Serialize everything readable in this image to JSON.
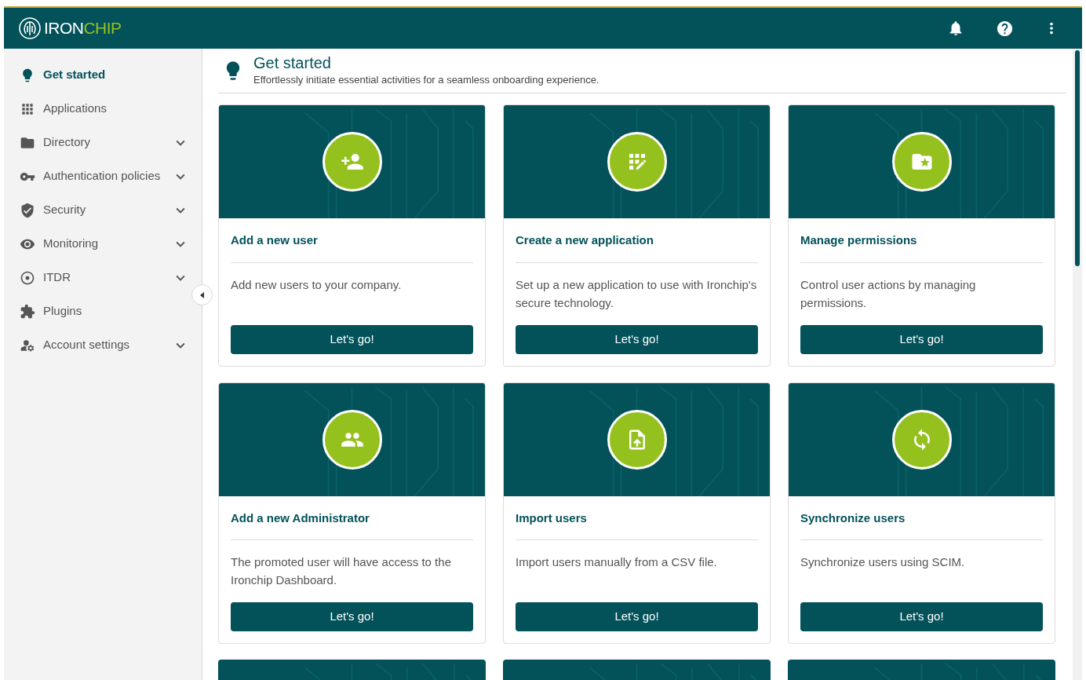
{
  "topbar": {
    "logo": {
      "part_1": "IRON",
      "part_2": "CHIP"
    }
  },
  "sidebar": {
    "items": [
      {
        "label": "Get started",
        "selected": true
      },
      {
        "label": "Applications",
        "selected": false
      },
      {
        "label": "Directory",
        "selected": false,
        "expanded": false
      },
      {
        "label": "Authentication policies",
        "selected": false,
        "expanded": false
      },
      {
        "label": "Security",
        "selected": false,
        "expanded": false
      },
      {
        "label": "Monitoring",
        "selected": false,
        "expanded": false
      },
      {
        "label": "ITDR",
        "selected": false,
        "expanded": false
      },
      {
        "label": "Plugins",
        "selected": false
      },
      {
        "label": "Account settings",
        "selected": false,
        "expanded": false
      }
    ]
  },
  "page": {
    "title": "Get started",
    "subtitle": "Effortlessly initiate essential activities for a seamless onboarding experience."
  },
  "cards": [
    {
      "title": "Add a new user",
      "description": "Add new users to your company.",
      "button": "Let's go!"
    },
    {
      "title": "Create a new application",
      "description": "Set up a new application to use with Ironchip's secure technology.",
      "button": "Let's go!"
    },
    {
      "title": "Manage permissions",
      "description": "Control user actions by managing permissions.",
      "button": "Let's go!"
    },
    {
      "title": "Add a new Administrator",
      "description": "The promoted user will have access to the Ironchip Dashboard.",
      "button": "Let's go!"
    },
    {
      "title": "Import users",
      "description": "Import users manually from a CSV file.",
      "button": "Let's go!"
    },
    {
      "title": "Synchronize users",
      "description": "Synchronize users using SCIM.",
      "button": "Let's go!"
    }
  ]
}
